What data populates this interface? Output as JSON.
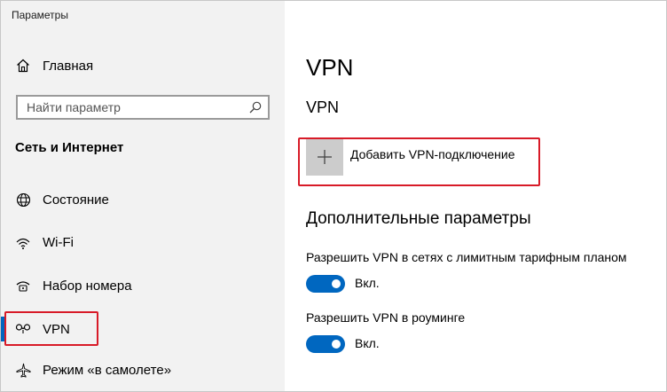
{
  "window": {
    "title": "Параметры"
  },
  "sidebar": {
    "home_label": "Главная",
    "search": {
      "placeholder": "Найти параметр",
      "value": ""
    },
    "section_heading": "Сеть и Интернет",
    "items": [
      {
        "label": "Состояние",
        "icon": "globe-icon"
      },
      {
        "label": "Wi-Fi",
        "icon": "wifi-icon"
      },
      {
        "label": "Набор номера",
        "icon": "dialup-icon"
      },
      {
        "label": "VPN",
        "icon": "vpn-icon",
        "selected": true
      },
      {
        "label": "Режим «в самолете»",
        "icon": "airplane-icon"
      }
    ]
  },
  "main": {
    "page_title": "VPN",
    "sub_title": "VPN",
    "add_vpn_label": "Добавить VPN-подключение",
    "advanced_heading": "Дополнительные параметры",
    "settings": [
      {
        "label": "Разрешить VPN в сетях с лимитным тарифным планом",
        "state_label": "Вкл.",
        "on": true
      },
      {
        "label": "Разрешить VPN в роуминге",
        "state_label": "Вкл.",
        "on": true
      }
    ]
  },
  "colors": {
    "accent": "#0067c0",
    "highlight_box": "#d81b28",
    "sidebar_bg": "#f2f2f2",
    "plus_tile": "#cccccc"
  }
}
